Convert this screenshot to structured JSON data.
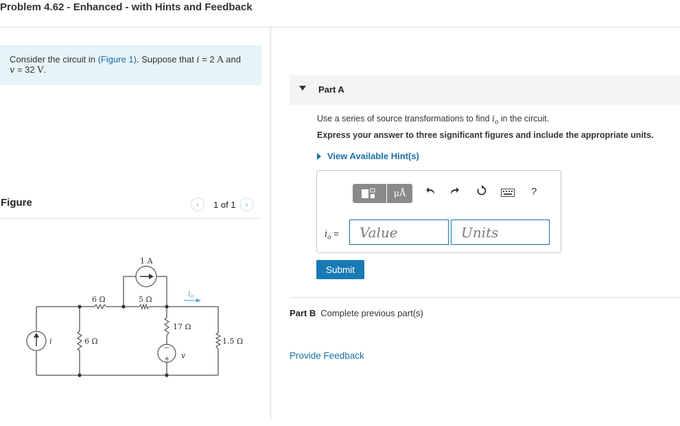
{
  "page": {
    "title": "Problem 4.62 - Enhanced - with Hints and Feedback"
  },
  "problem": {
    "text_before": "Consider the circuit in ",
    "figure_link": "(Figure 1)",
    "text_middle": ". Suppose that ",
    "var_i": "i",
    "eq_i": " = 2 ",
    "unit_i": "A",
    "text_and": " and",
    "var_v": "v",
    "eq_v": " = 32 ",
    "unit_v": "V",
    "period": "."
  },
  "figure": {
    "label": "Figure",
    "pager": "1 of 1",
    "prev_icon": "chevron-left-icon",
    "next_icon": "chevron-right-icon",
    "circuit": {
      "source_1A": "1 A",
      "r_6_top": "6 Ω",
      "r_5_top": "5 Ω",
      "r_6_shunt": "6 Ω",
      "r_17": "17 Ω",
      "r_1_5": "1.5 Ω",
      "var_i": "i",
      "var_v": "v",
      "var_io": "i",
      "var_io_sub": "o",
      "plus": "+",
      "minus": "−"
    }
  },
  "partA": {
    "label": "Part A",
    "instruction_pre": "Use a series of source transformations to find ",
    "instruction_var": "i",
    "instruction_sub": "o",
    "instruction_post": " in the circuit.",
    "express": "Express your answer to three significant figures and include the appropriate units.",
    "hints": "View Available Hint(s)",
    "toolbar": {
      "template_icon": "templates-icon",
      "units_btn": "μÅ",
      "undo_icon": "undo-icon",
      "redo_icon": "redo-icon",
      "reset_icon": "reset-icon",
      "keyboard_icon": "keyboard-icon",
      "help": "?"
    },
    "answer_label_var": "i",
    "answer_label_sub": "o",
    "answer_label_eq": " =",
    "value_placeholder": "Value",
    "units_placeholder": "Units",
    "submit": "Submit"
  },
  "partB": {
    "label": "Part B",
    "text": "Complete previous part(s)"
  },
  "feedback": "Provide Feedback",
  "colors": {
    "link": "#1a6fa6",
    "submit_bg": "#177ab5",
    "problem_bg": "#e6f3f7",
    "toolbar_gray": "#8a8a8a"
  }
}
